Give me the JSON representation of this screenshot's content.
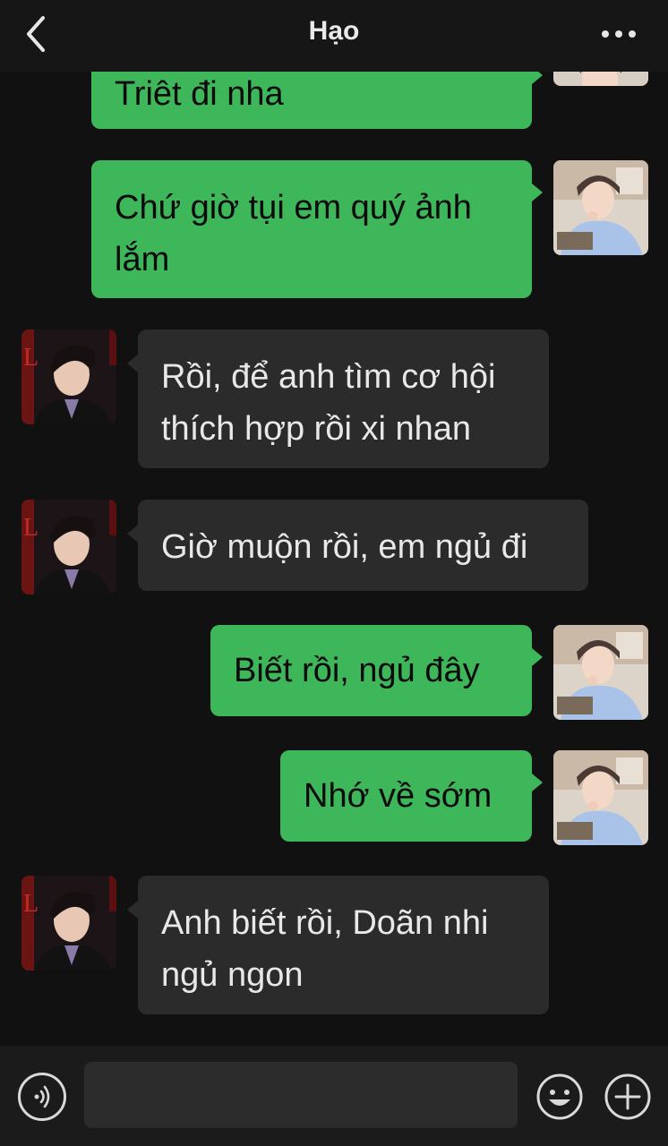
{
  "header": {
    "title": "Hạo",
    "back_icon": "chevron-left-icon",
    "more_icon": "more-dots-icon"
  },
  "messages": [
    {
      "side": "sent",
      "text": "Triêt đi nha"
    },
    {
      "side": "sent",
      "text": "Chứ giờ tụi em quý ảnh lắm"
    },
    {
      "side": "received",
      "text": "Rồi, để anh tìm cơ hội thích hợp rồi xi nhan"
    },
    {
      "side": "received",
      "text": "Giờ muộn rồi, em ngủ đi"
    },
    {
      "side": "sent",
      "text": "Biết rồi, ngủ đây"
    },
    {
      "side": "sent",
      "text": "Nhớ về sớm"
    },
    {
      "side": "received",
      "text": "Anh biết rồi, Doãn nhi ngủ ngon"
    }
  ],
  "composer": {
    "voice_icon": "voice-icon",
    "input_value": "",
    "emoji_icon": "emoji-icon",
    "plus_icon": "plus-icon"
  },
  "colors": {
    "sent_bubble": "#3eb65a",
    "received_bubble": "#2b2b2b",
    "background": "#111111"
  }
}
